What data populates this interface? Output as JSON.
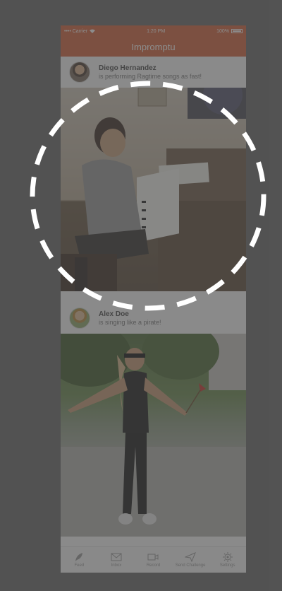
{
  "app": {
    "title": "Impromptu"
  },
  "status_bar": {
    "carrier": "•••• Carrier",
    "time": "1:20 PM",
    "battery": "100%"
  },
  "feed": {
    "posts": [
      {
        "author": "Diego Hernandez",
        "caption": "is performing Ragtime songs as fast!"
      },
      {
        "author": "Alex Doe",
        "caption": "is singing like a pirate!"
      }
    ]
  },
  "tab_bar": {
    "items": [
      {
        "label": "Feed",
        "icon": "feather-icon"
      },
      {
        "label": "Inbox",
        "icon": "envelope-icon"
      },
      {
        "label": "Record",
        "icon": "camera-icon"
      },
      {
        "label": "Send Challenge",
        "icon": "paper-plane-icon"
      },
      {
        "label": "Settings",
        "icon": "gear-icon"
      }
    ]
  },
  "overlay": {
    "highlight": "dashed circle around first post photo"
  },
  "colors": {
    "accent": "#d4633c",
    "overlay": "#464646"
  }
}
